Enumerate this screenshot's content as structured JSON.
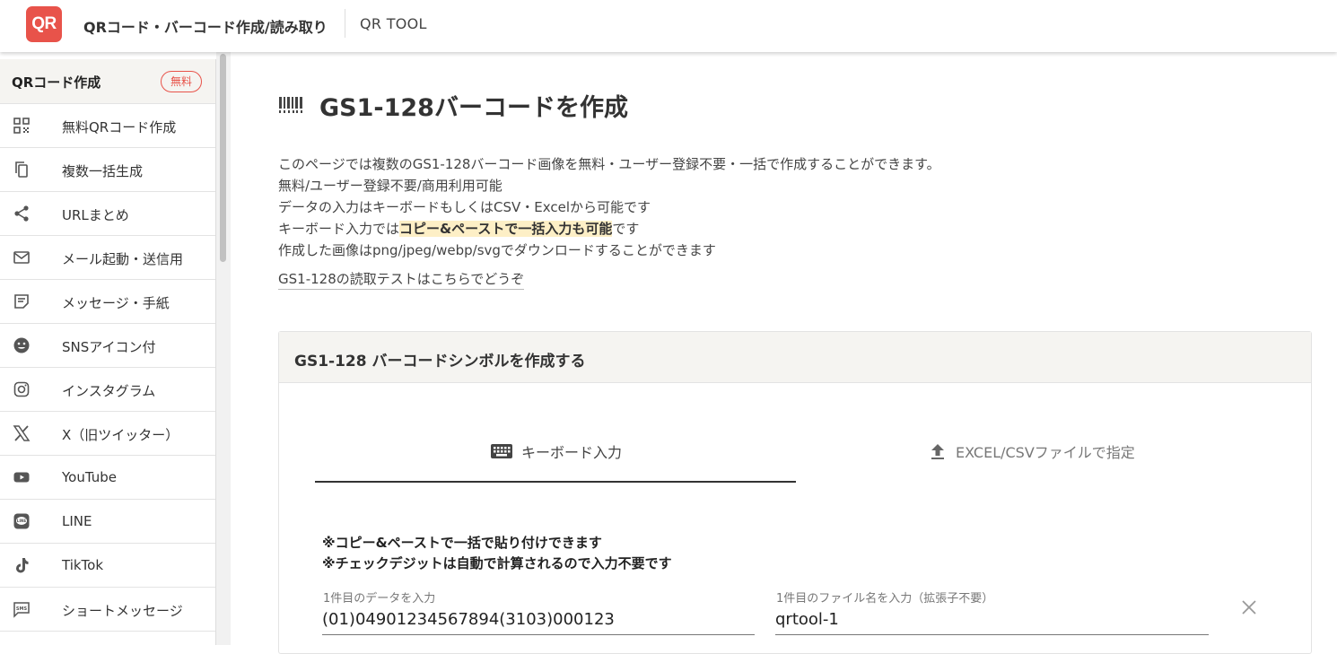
{
  "header": {
    "logo": "QR",
    "site_title": "QRコード・バーコード作成/読み取り",
    "sub_title": "QR TOOL"
  },
  "sidebar": {
    "section_title": "QRコード作成",
    "badge": "無料",
    "items": [
      {
        "label": "無料QRコード作成",
        "icon": "qr-grid-icon"
      },
      {
        "label": "複数一括生成",
        "icon": "copy-icon"
      },
      {
        "label": "URLまとめ",
        "icon": "share-icon"
      },
      {
        "label": "メール起動・送信用",
        "icon": "mail-icon"
      },
      {
        "label": "メッセージ・手紙",
        "icon": "note-icon"
      },
      {
        "label": "SNSアイコン付",
        "icon": "smiley-icon"
      },
      {
        "label": "インスタグラム",
        "icon": "instagram-icon"
      },
      {
        "label": "X（旧ツイッター）",
        "icon": "x-icon"
      },
      {
        "label": "YouTube",
        "icon": "youtube-icon"
      },
      {
        "label": "LINE",
        "icon": "line-icon"
      },
      {
        "label": "TikTok",
        "icon": "tiktok-icon"
      },
      {
        "label": "ショートメッセージ",
        "icon": "sms-icon"
      }
    ]
  },
  "main": {
    "title": "GS1-128バーコードを作成",
    "desc_lines": [
      "このページでは複数のGS1-128バーコード画像を無料・ユーザー登録不要・一括で作成することができます。",
      "無料/ユーザー登録不要/商用利用可能",
      "データの入力はキーボードもしくはCSV・Excelから可能です"
    ],
    "desc4_prefix": "キーボード入力では",
    "desc4_highlight": "コピー&ペーストで一括入力も可能",
    "desc4_suffix": "です",
    "desc5": "作成した画像はpng/jpeg/webp/svgでダウンロードすることができます",
    "read_link": "GS1-128の読取テストはこちらでどうぞ",
    "card_title": "GS1-128 バーコードシンボルを作成する",
    "tabs": {
      "keyboard": "キーボード入力",
      "file": "EXCEL/CSVファイルで指定"
    },
    "notes": [
      "※コピー&ペーストで一括で貼り付けできます",
      "※チェックデジットは自動で計算されるので入力不要です"
    ],
    "data_label": "1件目のデータを入力",
    "data_value": "(01)04901234567894(3103)000123",
    "filename_label": "1件目のファイル名を入力（拡張子不要）",
    "filename_value": "qrtool-1"
  }
}
